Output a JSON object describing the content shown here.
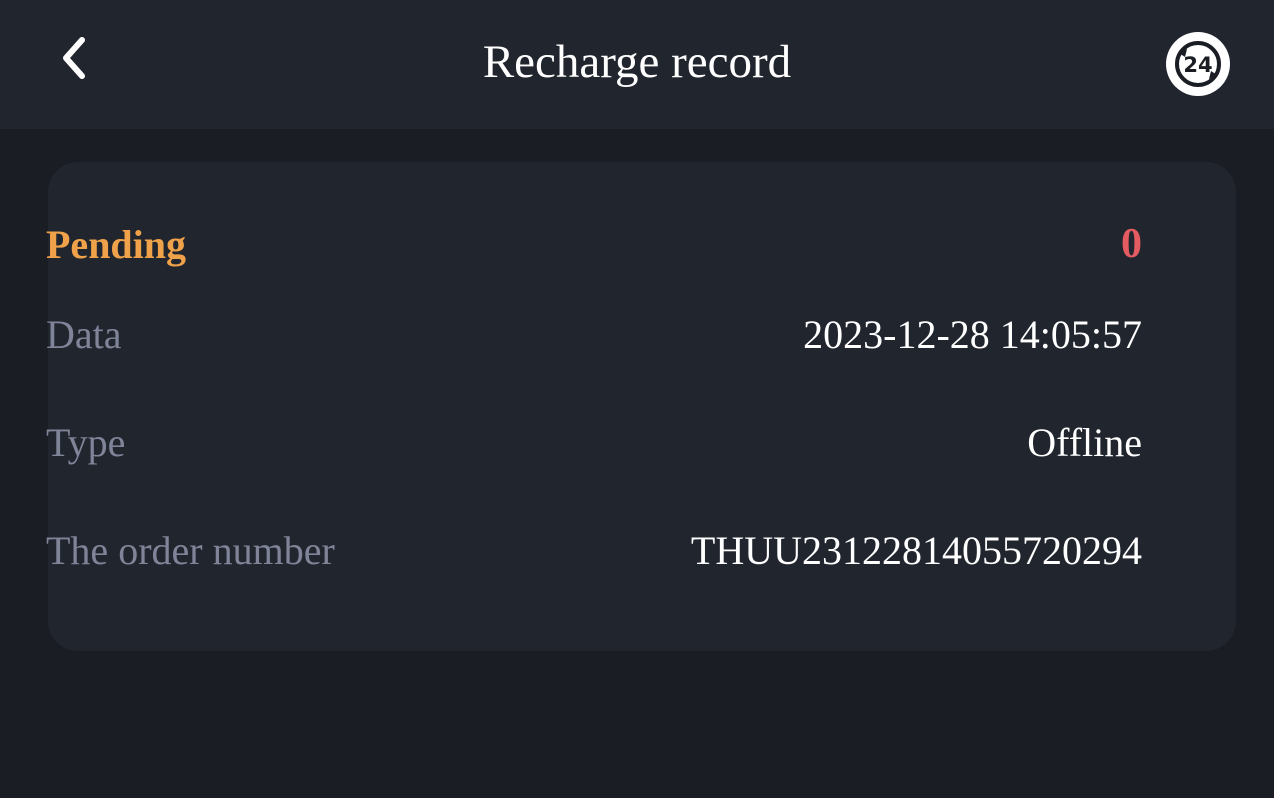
{
  "header": {
    "title": "Recharge record",
    "back_icon": "chevron-left-icon",
    "support_icon": "support-24h-icon",
    "support_icon_text": "24"
  },
  "record": {
    "status": "Pending",
    "amount": "0",
    "fields": [
      {
        "label": "Data",
        "value": "2023-12-28 14:05:57"
      },
      {
        "label": "Type",
        "value": "Offline"
      },
      {
        "label": "The order number",
        "value": "THUU23122814055720294"
      }
    ]
  },
  "colors": {
    "background": "#1a1d24",
    "panel": "#21252e",
    "status_pending": "#f0a24a",
    "amount": "#e45b62",
    "label": "#7f8498",
    "value": "#ffffff"
  }
}
